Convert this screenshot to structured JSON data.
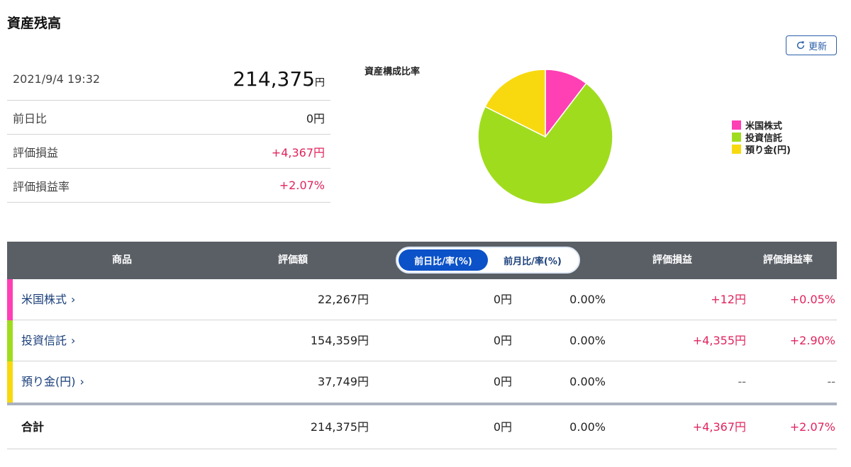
{
  "page": {
    "title": "資産残高"
  },
  "refresh": {
    "label": "更新"
  },
  "summary": {
    "datetime": "2021/9/4 19:32",
    "total_value": "214,375",
    "total_unit": "円",
    "rows": [
      {
        "label": "前日比",
        "value": "0円"
      },
      {
        "label": "評価損益",
        "value": "+4,367円"
      },
      {
        "label": "評価損益率",
        "value": "+2.07%"
      }
    ]
  },
  "chart_data": {
    "type": "pie",
    "title": "資産構成比率",
    "legend_position": "right",
    "slices": [
      {
        "name": "米国株式",
        "value": 22267,
        "color": "#ff3fb4"
      },
      {
        "name": "投資信託",
        "value": 154359,
        "color": "#a0dc1e"
      },
      {
        "name": "預り金(円)",
        "value": 37749,
        "color": "#f8d90f"
      }
    ]
  },
  "table": {
    "headers": {
      "product": "商品",
      "valuation": "評価額",
      "pl": "評価損益",
      "pl_rate": "評価損益率"
    },
    "toggle": {
      "daily": "前日比/率(%)",
      "monthly": "前月比/率(%)",
      "selected": "daily"
    },
    "rows": [
      {
        "name": "米国株式",
        "valuation": "22,267円",
        "change": "0円",
        "change_rate": "0.00%",
        "pl": "+12円",
        "pl_rate": "+0.05%",
        "color": "#ff3fb4"
      },
      {
        "name": "投資信託",
        "valuation": "154,359円",
        "change": "0円",
        "change_rate": "0.00%",
        "pl": "+4,355円",
        "pl_rate": "+2.90%",
        "color": "#a0dc1e"
      },
      {
        "name": "預り金(円)",
        "valuation": "37,749円",
        "change": "0円",
        "change_rate": "0.00%",
        "pl": "--",
        "pl_rate": "--",
        "color": "#f8d90f"
      }
    ],
    "total": {
      "name": "合計",
      "valuation": "214,375円",
      "change": "0円",
      "change_rate": "0.00%",
      "pl": "+4,367円",
      "pl_rate": "+2.07%"
    }
  }
}
